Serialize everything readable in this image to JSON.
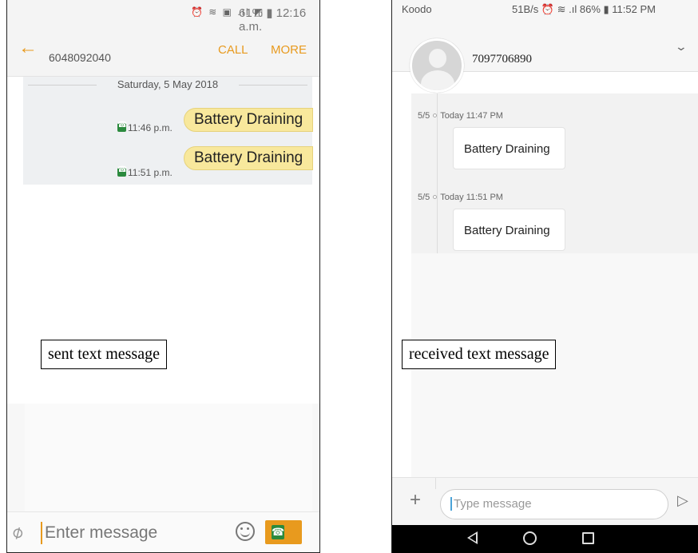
{
  "left_phone": {
    "status_time": "12:16 a.m.",
    "battery": "61%",
    "contact_number": "6048092040",
    "call_label": "CALL",
    "more_label": "MORE",
    "date_header": "Saturday, 5 May 2018",
    "messages": [
      {
        "text": "Battery Draining",
        "time": "11:46 p.m."
      },
      {
        "text": "Battery Draining",
        "time": "11:51 p.m."
      }
    ],
    "input_placeholder": "Enter message",
    "annotation": "sent text message",
    "colors": {
      "accent": "#e89a1e",
      "bubble": "#f8e89c"
    }
  },
  "right_phone": {
    "carrier": "Koodo",
    "status_info": "51B/s ⏰ ≋ .ıl 86% ▮ 11:52 PM",
    "contact_number": "7097706890",
    "messages": [
      {
        "stamp": "5/5",
        "time": "Today 11:47 PM",
        "text": "Battery Draining"
      },
      {
        "stamp": "5/5",
        "time": "Today 11:51 PM",
        "text": "Battery Draining"
      }
    ],
    "input_placeholder": "Type message",
    "annotation": "received text message"
  }
}
